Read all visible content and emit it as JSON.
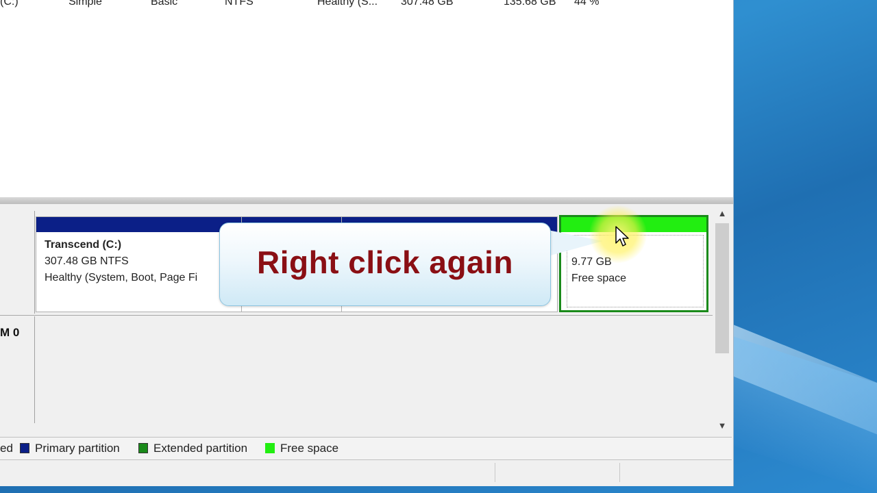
{
  "volume_row": [
    "(C:)",
    "Simple",
    "Basic",
    "NTFS",
    "Healthy (S...",
    "307.48 GB",
    "135.68 GB",
    "44 %"
  ],
  "disk_label": "M 0",
  "partitions": {
    "c_drive": {
      "title": "Transcend (C:)",
      "size": "307.48 GB NTFS",
      "status": "Healthy (System, Boot, Page Fi"
    },
    "free": {
      "size": "9.77 GB",
      "label": "Free space"
    }
  },
  "callout": {
    "text": "Right click again"
  },
  "legend": {
    "items": [
      {
        "label": "ed",
        "color": ""
      },
      {
        "label": "Primary partition",
        "color": "#0b1f87"
      },
      {
        "label": "Extended partition",
        "color": "#1a8a1a"
      },
      {
        "label": "Free space",
        "color": "#22ee11"
      }
    ]
  },
  "scroll": {
    "up_glyph": "▲",
    "down_glyph": "▼"
  }
}
